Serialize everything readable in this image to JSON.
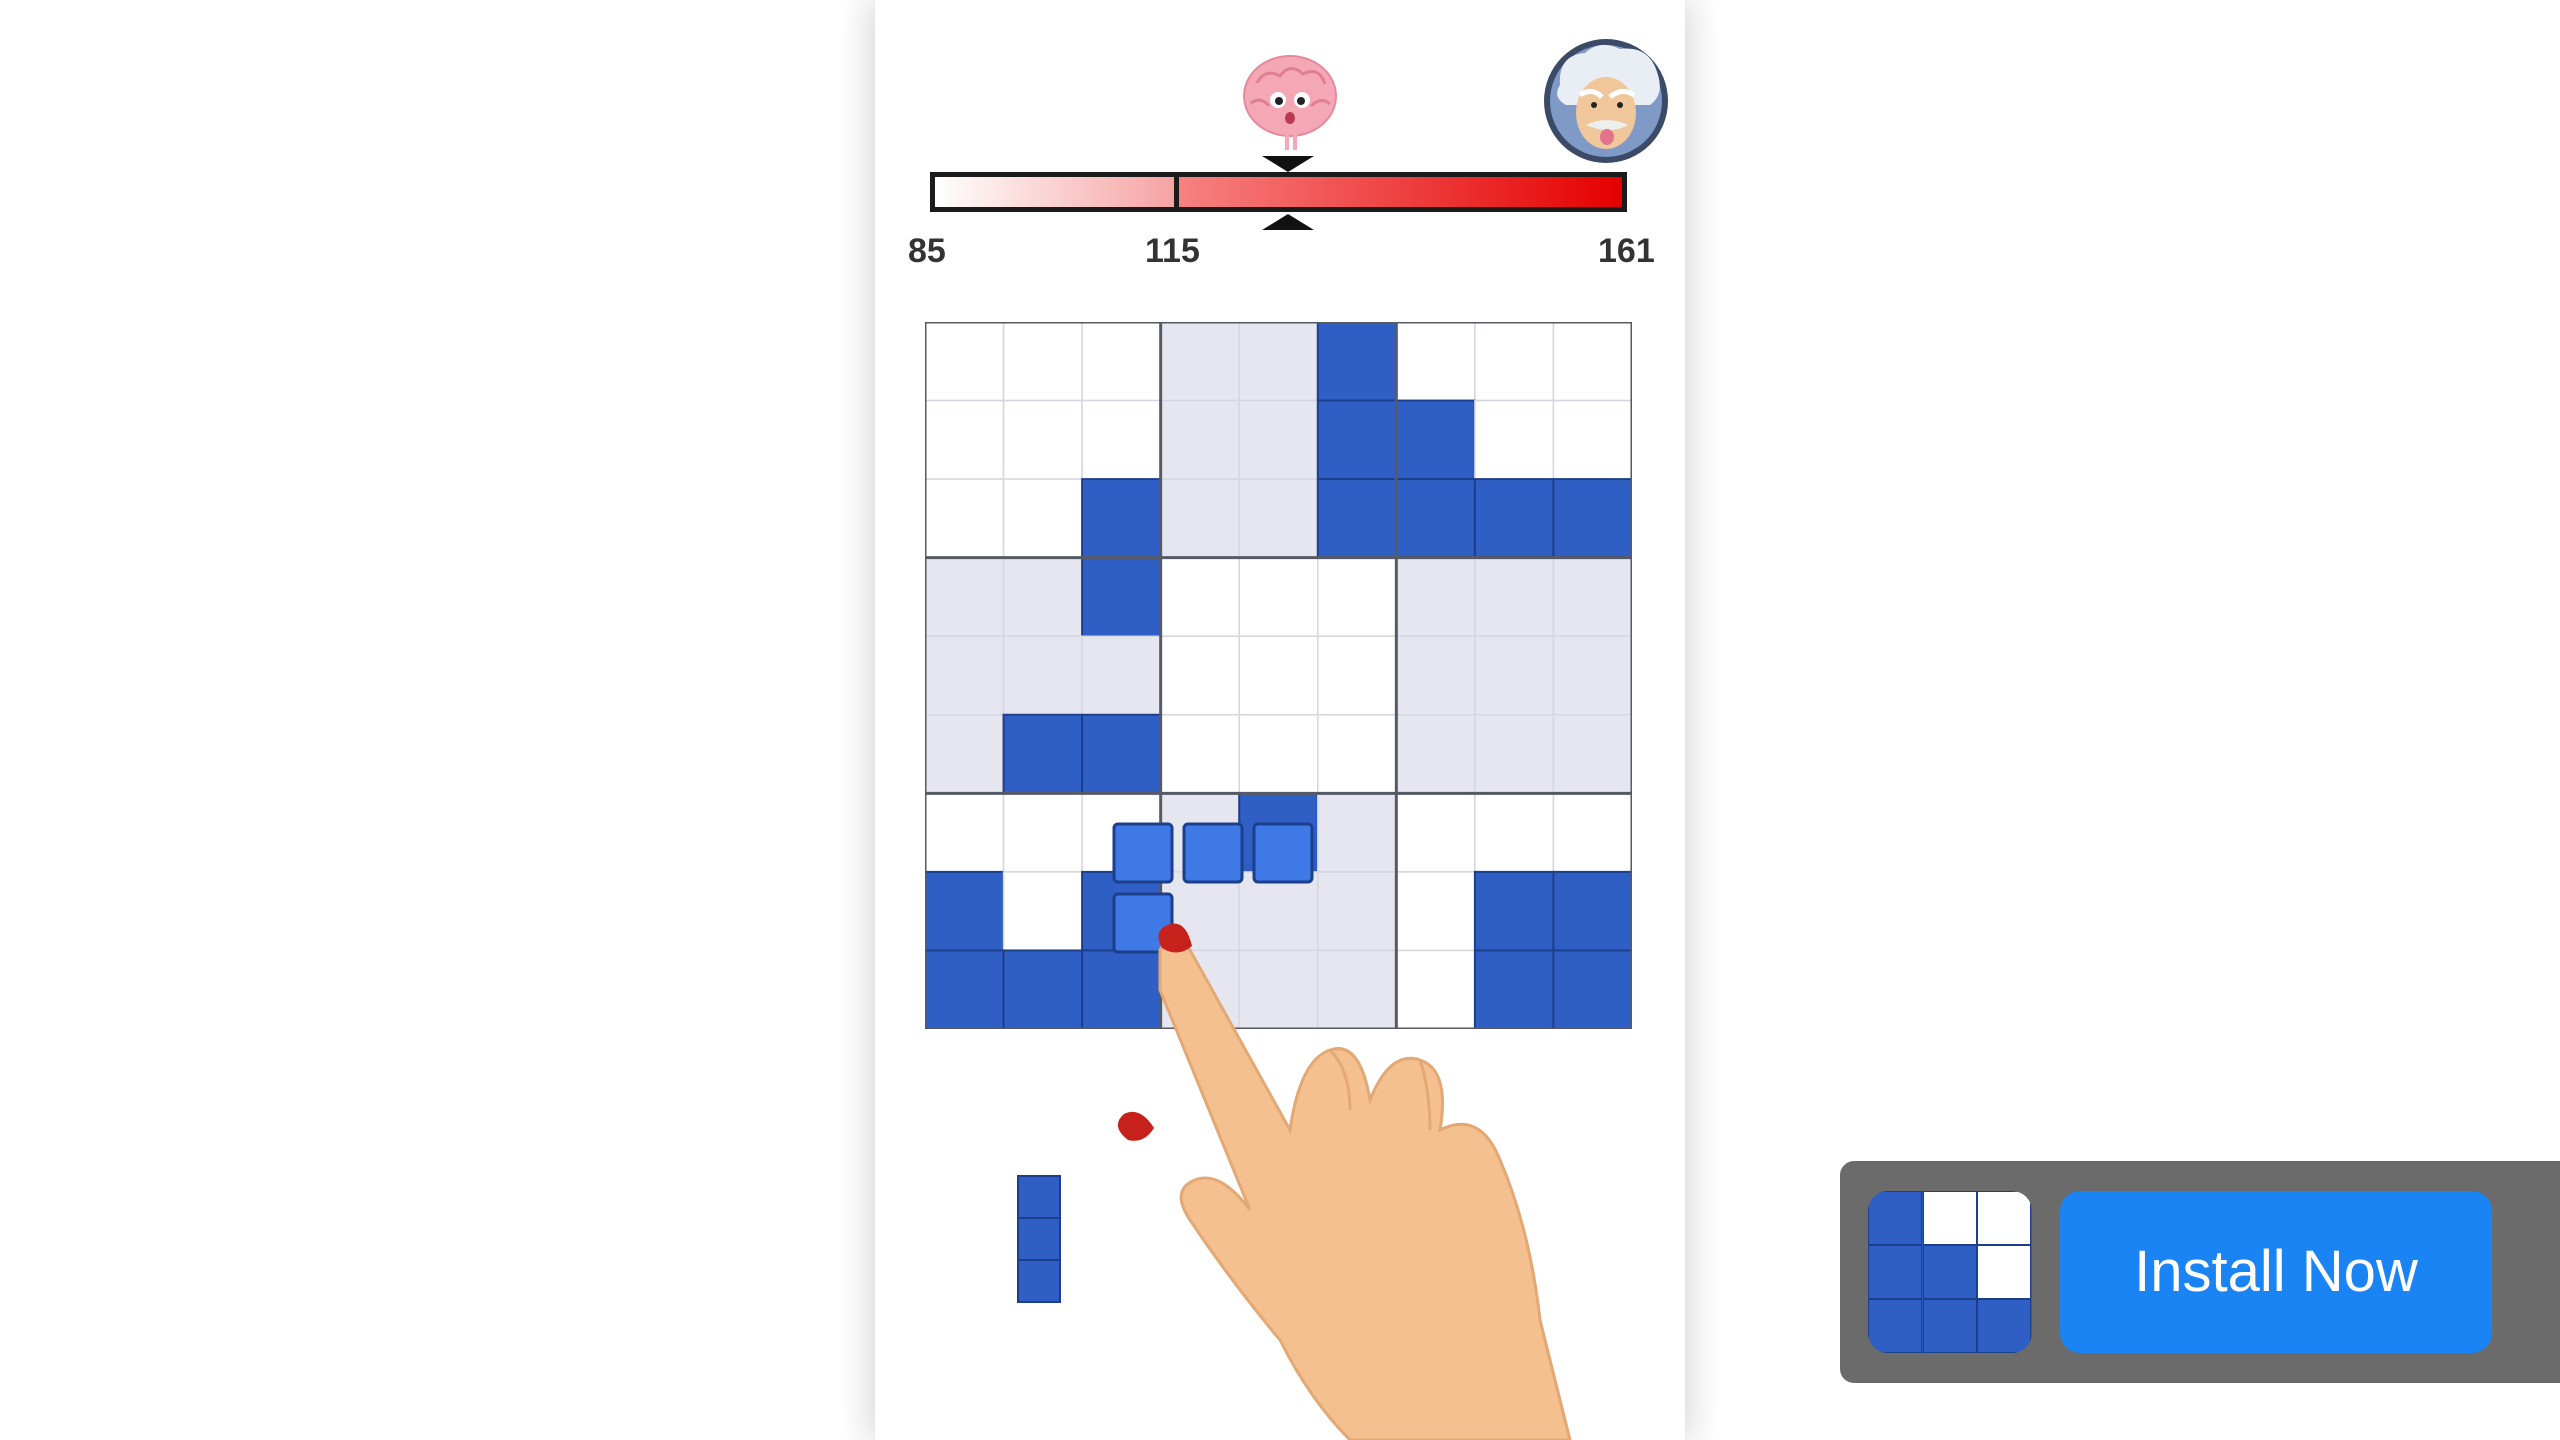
{
  "iq_meter": {
    "min_label": "85",
    "mid_label": "115",
    "max_label": "161",
    "fill_color_start": "#ffffff",
    "fill_color_end": "#e50000"
  },
  "mascots": {
    "brain_icon": "brain-mascot-icon",
    "avatar_icon": "einstein-avatar-icon"
  },
  "board": {
    "size": 9,
    "filled_color": "#2f5fc4",
    "dark_filled_color": "#2a54b0",
    "shaded_color": "#e6e6f0",
    "filled_cells": [
      [
        0,
        5
      ],
      [
        1,
        5
      ],
      [
        1,
        6
      ],
      [
        2,
        2
      ],
      [
        2,
        5
      ],
      [
        2,
        6
      ],
      [
        2,
        7
      ],
      [
        2,
        8
      ],
      [
        3,
        2
      ],
      [
        5,
        1
      ],
      [
        5,
        2
      ],
      [
        6,
        4
      ],
      [
        7,
        0
      ],
      [
        7,
        2
      ],
      [
        7,
        7
      ],
      [
        7,
        8
      ],
      [
        8,
        0
      ],
      [
        8,
        1
      ],
      [
        8,
        2
      ],
      [
        8,
        7
      ],
      [
        8,
        8
      ]
    ]
  },
  "dragged_piece": {
    "color": "#3f79e6",
    "shape": [
      [
        0,
        0
      ],
      [
        0,
        1
      ],
      [
        0,
        2
      ],
      [
        1,
        0
      ]
    ]
  },
  "tray": {
    "piece_color": "#2f5fc4",
    "shape": [
      [
        0,
        0
      ],
      [
        1,
        0
      ],
      [
        2,
        0
      ]
    ]
  },
  "banner": {
    "install_label": "Install Now",
    "button_color": "#1a84f5"
  }
}
